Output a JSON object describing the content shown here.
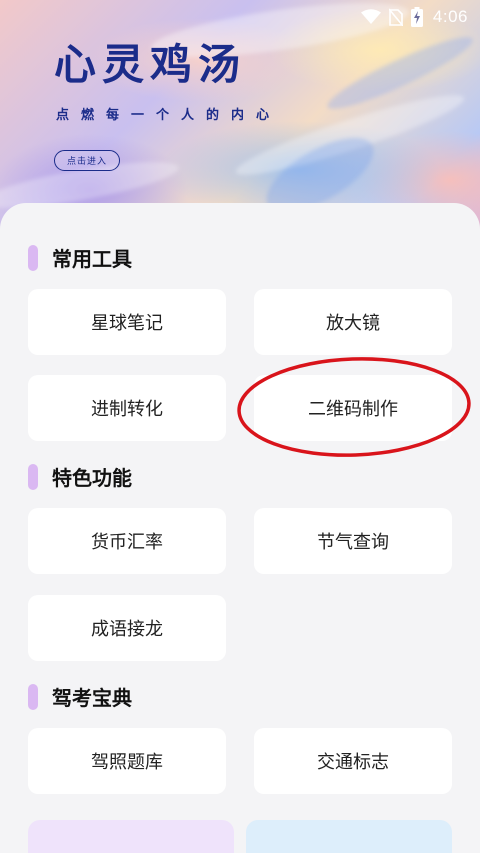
{
  "status_bar": {
    "time": "4:06",
    "icons": [
      "wifi-icon",
      "no-sim-icon",
      "battery-charging-icon"
    ]
  },
  "hero": {
    "title": "心灵鸡汤",
    "subtitle": "点燃每一个人的内心",
    "enter_button": "点击进入"
  },
  "sections": [
    {
      "title": "常用工具",
      "items": [
        "星球笔记",
        "放大镜",
        "进制转化",
        "二维码制作"
      ]
    },
    {
      "title": "特色功能",
      "items": [
        "货币汇率",
        "节气查询",
        "成语接龙"
      ]
    },
    {
      "title": "驾考宝典",
      "items": [
        "驾照题库",
        "交通标志"
      ]
    }
  ],
  "colors": {
    "accent_bar": "#dab8f2",
    "hero_title": "#1b2c8a",
    "annotation_circle": "#d9141b",
    "bottom_card_left": "#efe3fb",
    "bottom_card_right": "#ddeefb"
  }
}
